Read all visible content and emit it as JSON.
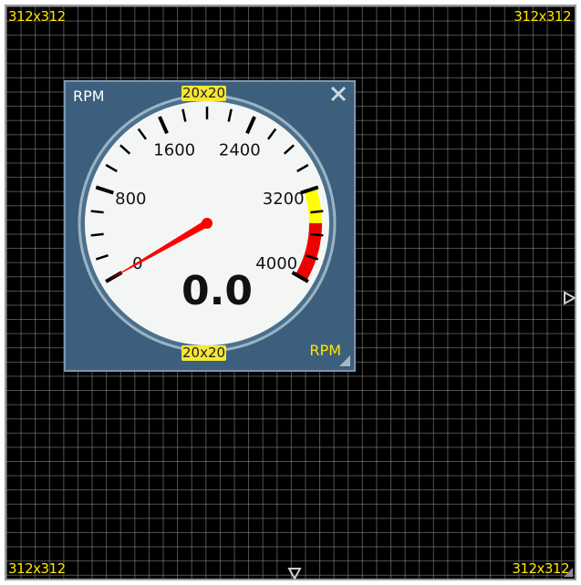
{
  "canvas": {
    "corner_labels": {
      "top_left": "312x312",
      "top_right": "312x312",
      "bottom_left": "312x312",
      "bottom_right": "312x312"
    }
  },
  "gauge": {
    "title": "RPM",
    "unit_label": "RPM",
    "value_display": "0.0",
    "value": 0,
    "min": 0,
    "max": 4000,
    "tick_labels": [
      "0",
      "800",
      "1600",
      "2400",
      "3200",
      "4000"
    ],
    "top_badge": "20x20",
    "bottom_badge": "20x20",
    "colors": {
      "panel": "#3b5f7c",
      "face": "#f4f6f6",
      "needle": "#ff0000",
      "warning_zone": "#ffff00",
      "danger_zone": "#ee0000",
      "badge": "#f7e632",
      "label_accent": "#ffe600"
    },
    "zones": {
      "warning": [
        3200,
        3500
      ],
      "danger": [
        3500,
        4000
      ]
    }
  },
  "icons": {
    "close": "close-icon",
    "resize": "resize-handle-icon",
    "right_arrow": "expand-right-arrow-icon",
    "down_arrow": "expand-down-arrow-icon"
  }
}
